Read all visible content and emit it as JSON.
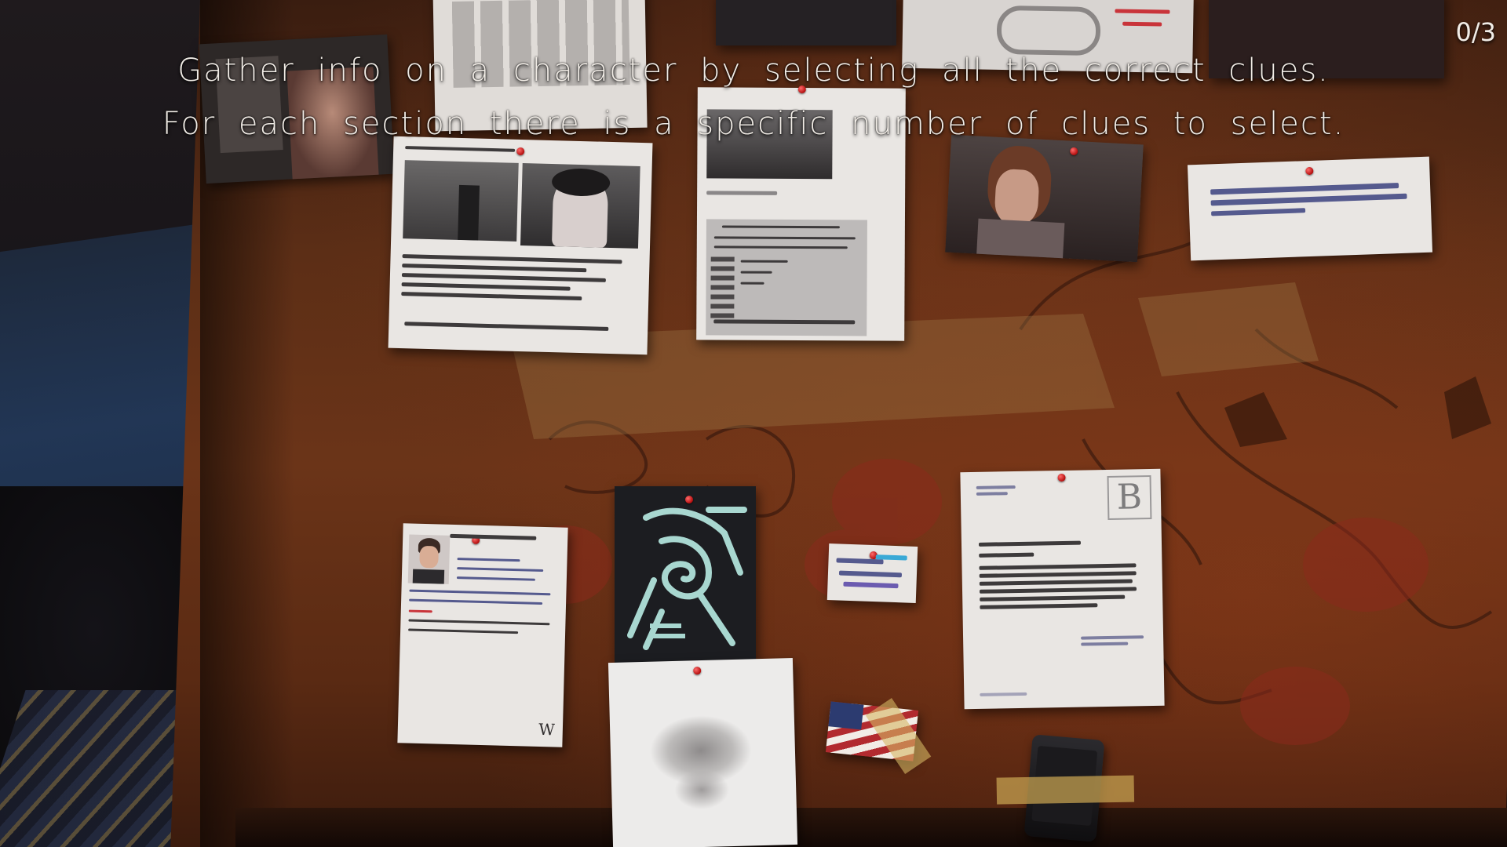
{
  "hud": {
    "counter": "0/3",
    "instruction_line1": "Gather info on a character by selecting all the correct clues.",
    "instruction_line2": "For each section there is a specific number of clues to select."
  },
  "clues": {
    "letterhead_letter": {
      "logo": "B"
    },
    "student_profile": {
      "corner_mark": "W"
    }
  }
}
